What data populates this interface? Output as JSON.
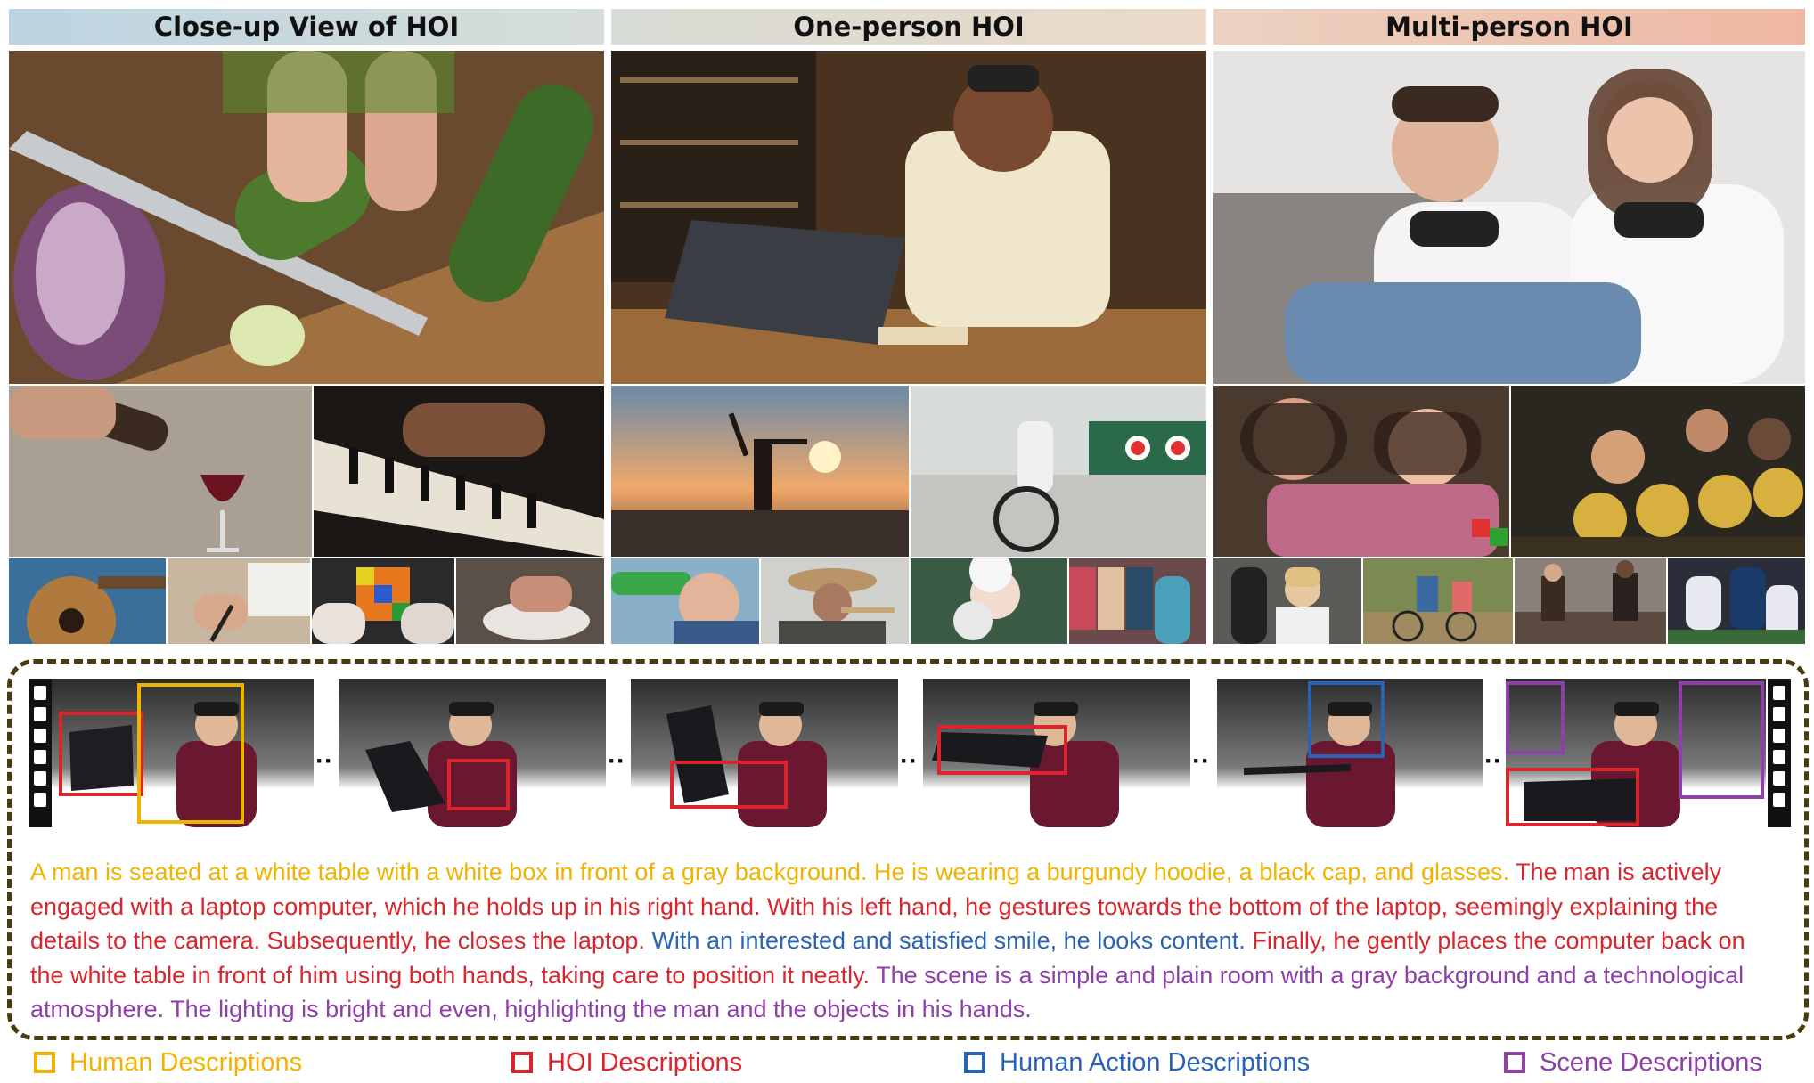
{
  "headers": {
    "closeup": "Close-up View of HOI",
    "one_person": "One-person HOI",
    "multi_person": "Multi-person HOI"
  },
  "caption": {
    "human": "A man is seated at a white table with a white box in front of a gray background. He is wearing a burgundy hoodie, a black cap, and glasses.",
    "hoi_1": "The man is actively engaged with a laptop computer, which he holds up in his right hand. With his left hand, he gestures towards the bottom of the laptop, seemingly explaining the details to the camera. Subsequently, he closes the laptop.",
    "action": "With an interested and satisfied smile, he looks content.",
    "hoi_2": "Finally, he gently places the computer back on the white table in front of him using both hands, taking care to position it neatly.",
    "scene": "The scene is a simple and plain room with a gray background and a technological atmosphere. The lighting is bright and even, highlighting the man and the objects in his hands."
  },
  "legend": {
    "human": "Human Descriptions",
    "hoi": "HOI Descriptions",
    "action": "Human Action Descriptions",
    "scene": "Scene Descriptions"
  },
  "colors": {
    "human": "#f0b400",
    "hoi": "#d9262e",
    "action": "#2a62b8",
    "scene": "#8e3fa8",
    "border": "#4a3a10"
  },
  "ellipsis": "··"
}
